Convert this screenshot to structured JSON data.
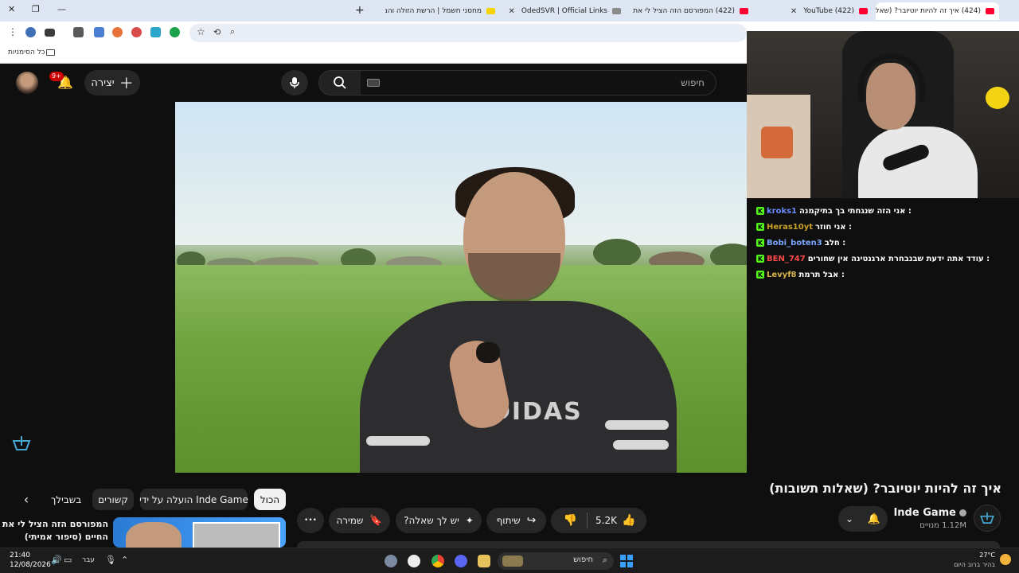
{
  "browser": {
    "tabs": [
      {
        "title": "(424) איך זה להיות יוטיובר? (שאלות",
        "active": true
      },
      {
        "title": "(422) YouTube",
        "active": false
      },
      {
        "title": "(422) המפורסם הזה הציל לי את",
        "active": false
      },
      {
        "title": "OdedSVR | Official Links",
        "active": false
      },
      {
        "title": "מחסני חשמל | הרשת הזולה והמ",
        "active": false
      }
    ],
    "bookmarks_label": "כל הסימניות",
    "new_tab": "+",
    "close_window": "✕"
  },
  "youtube": {
    "search_placeholder": "חיפוש",
    "create_label": "יצירה",
    "notifications_count": "9+"
  },
  "chat": [
    {
      "user": "kroks1",
      "message": "אני הזה שנגחתי בך בתיקמנה :",
      "user_color": "#6a8cff"
    },
    {
      "user": "Heras10yt",
      "message": "אני חוזר :",
      "user_color": "#c9a227"
    },
    {
      "user": "Bobi_boten3",
      "message": "חלב :",
      "user_color": "#7aa6ff"
    },
    {
      "user": "BEN_747",
      "message": "עודד אתה ידעת שבנבחרת ארגנטינה אין שחורים :",
      "user_color": "#ff4a4a"
    },
    {
      "user": "Levyf8",
      "message": "אבל תרמת :",
      "user_color": "#d9b44a"
    }
  ],
  "video": {
    "title": "איך זה להיות יוטיובר? (שאלות תשובות)",
    "jersey_text": "DIDAS"
  },
  "channel": {
    "name": "Inde Game",
    "subscribers": "1.12M מנויים"
  },
  "actions": {
    "likes": "5.2K",
    "share": "שיתוף",
    "ask": "יש לך שאלה?",
    "save": "שמירה",
    "more": "•••"
  },
  "chips": {
    "all": "הכול",
    "uploaded_by": "הועלה על ידי Inde Game",
    "related": "קשורים",
    "for_you": "בשבילך"
  },
  "next_video": {
    "title_line1": "המפורסם הזה הציל לי את",
    "title_line2": "החיים (סיפור אמיתי)"
  },
  "taskbar": {
    "weather_temp": "27°C",
    "weather_desc": "בהיר ברוב היום",
    "search_label": "חיפוש",
    "time": "21:40",
    "date": "12/08/2026",
    "lang": "עבר"
  },
  "colors": {
    "yt_red": "#ff0033",
    "kick_green": "#53fc18",
    "bg": "#0f0f0f"
  }
}
